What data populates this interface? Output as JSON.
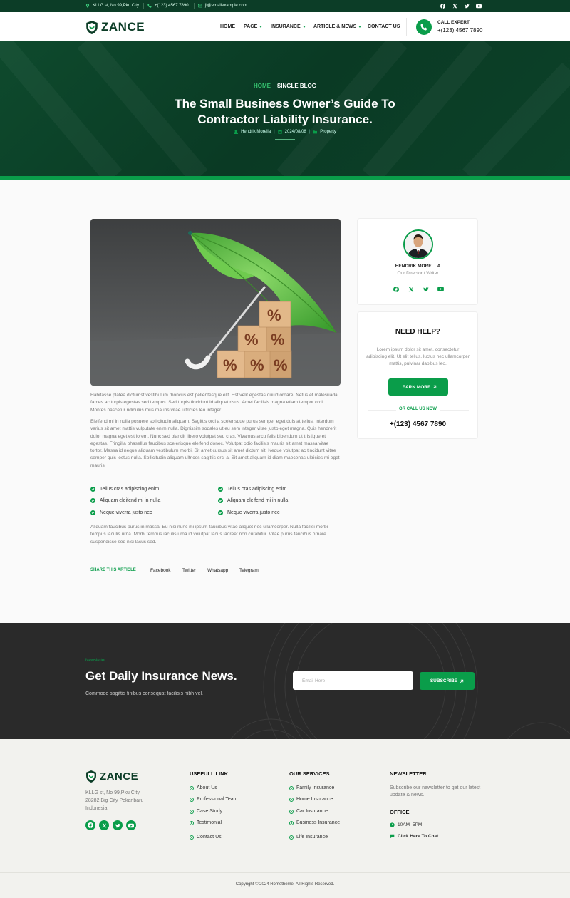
{
  "topbar": {
    "address": "KLLG st, No 99,Pku City",
    "phone": "+(123) 4567 7890",
    "email": "jl@emailexample.com"
  },
  "header": {
    "logo": "ZANCE",
    "nav": [
      "HOME",
      "PAGE",
      "INSURANCE",
      "ARTICLE & NEWS",
      "CONTACT US"
    ],
    "call_label": "CALL EXPERT",
    "call_number": "+(123) 4567 7890"
  },
  "hero": {
    "crumb_home": "HOME",
    "crumb_rest": " – SINGLE BLOG",
    "title_line1": "The Small Business Owner’s Guide To",
    "title_line2": "Contractor Liability Insurance.",
    "author": "Hendrik Morella",
    "date": "2024/08/08",
    "category": "Property"
  },
  "article": {
    "p1": "Habitasse platea dictumst vestibulum rhoncus est pellentesque elit. Est velit egestas dui id ornare. Netus et malesuada fames ac turpis egestas sed tempus. Sed turpis tincidunt id aliquet risus. Amet facilisis magna etiam tempor orci. Montes nascetur ridiculus mus mauris vitae ultricies leo integer.",
    "p2": "Eleifend mi in nulla posuere sollicitudin aliquam. Sagittis orci a scelerisque purus semper eget duis at tellus. Interdum varius sit amet mattis vulputate enim nulla. Dignissim sodales ut eu sem integer vitae justo eget magna. Quis hendrerit dolor magna eget est lorem. Nunc sed blandit libero volutpat sed cras. Vivamus arcu felis bibendum ut tristique et egestas. Fringilla phasellus faucibus scelerisque eleifend donec. Volutpat odio facilisis mauris sit amet massa vitae tortor. Massa id neque aliquam vestibulum morbi. Sit amet cursus sit amet dictum sit. Neque volutpat ac tincidunt vitae semper quis lectus nulla. Sollicitudin aliquam ultrices sagittis orci a. Sit amet aliquam id diam maecenas ultricies mi eget mauris.",
    "checks": [
      "Tellus cras adipiscing enim",
      "Aliquam eleifend mi in nulla",
      "Neque viverra justo nec",
      "Tellus cras adipiscing enim",
      "Aliquam eleifend mi in nulla",
      "Neque viverra justo nec"
    ],
    "p3": "Aliquam faucibus purus in massa. Eu nisi nunc mi ipsum faucibus vitae aliquet nec ullamcorper. Nulla facilisi morbi tempus iaculis urna. Morbi tempus iaculis urna id volutpat lacus laoreet non curabitur. Vitae purus faucibus ornare suspendisse sed nisi lacus sed.",
    "share_label": "SHARE THIS ARTICLE",
    "share_links": [
      "Facebook",
      "Twitter",
      "Whatsapp",
      "Telegram"
    ]
  },
  "author_card": {
    "name": "HENDRIK MORELLA",
    "role": "Our Director / Writer"
  },
  "help_card": {
    "title": "NEED HELP?",
    "text": "Lorem ipsum dolor sit amet, consectetur adipiscing elit. Ut elit tellus, luctus nec ullamcorper mattis, pulvinar dapibus leo.",
    "button": "LEARN MORE",
    "or_call": "OR CALL US NOW",
    "phone": "+(123) 4567 7890"
  },
  "newsletter": {
    "tag": "Newsletter",
    "title": "Get Daily Insurance News.",
    "subtitle": "Commodo sagittis finibus consequat facilisis nibh vel.",
    "placeholder": "Email Here",
    "button": "SUBSCRIBE"
  },
  "footer": {
    "logo": "ZANCE",
    "address_l1": "KLLG st, No 99,Pku City,",
    "address_l2": "28282 Big City Pekanbaru",
    "address_l3": "Indonesia",
    "col1_title": "USEFULL LINK",
    "col1_links": [
      "About Us",
      "Professional Team",
      "Case Study",
      "Testimonial",
      "Contact Us"
    ],
    "col2_title": "OUR SERVICES",
    "col2_links": [
      "Family Insurance",
      "Home Insurance",
      "Car Insurance",
      "Business Insurance",
      "Life Insurance"
    ],
    "col3_title": "NEWSLETTER",
    "col3_text": "Subscribe our newsletter to get our latest update & news.",
    "office_title": "OFFICE",
    "office_hours": "10AM- 5PM",
    "chat": "Click Here To Chat",
    "copyright": "Copyright © 2024 Rometheme. All Rights Reserved."
  },
  "colors": {
    "brand_green": "#0a9d4a",
    "dark_green": "#0c3d27",
    "newsletter_bg": "#2a2a2a"
  }
}
